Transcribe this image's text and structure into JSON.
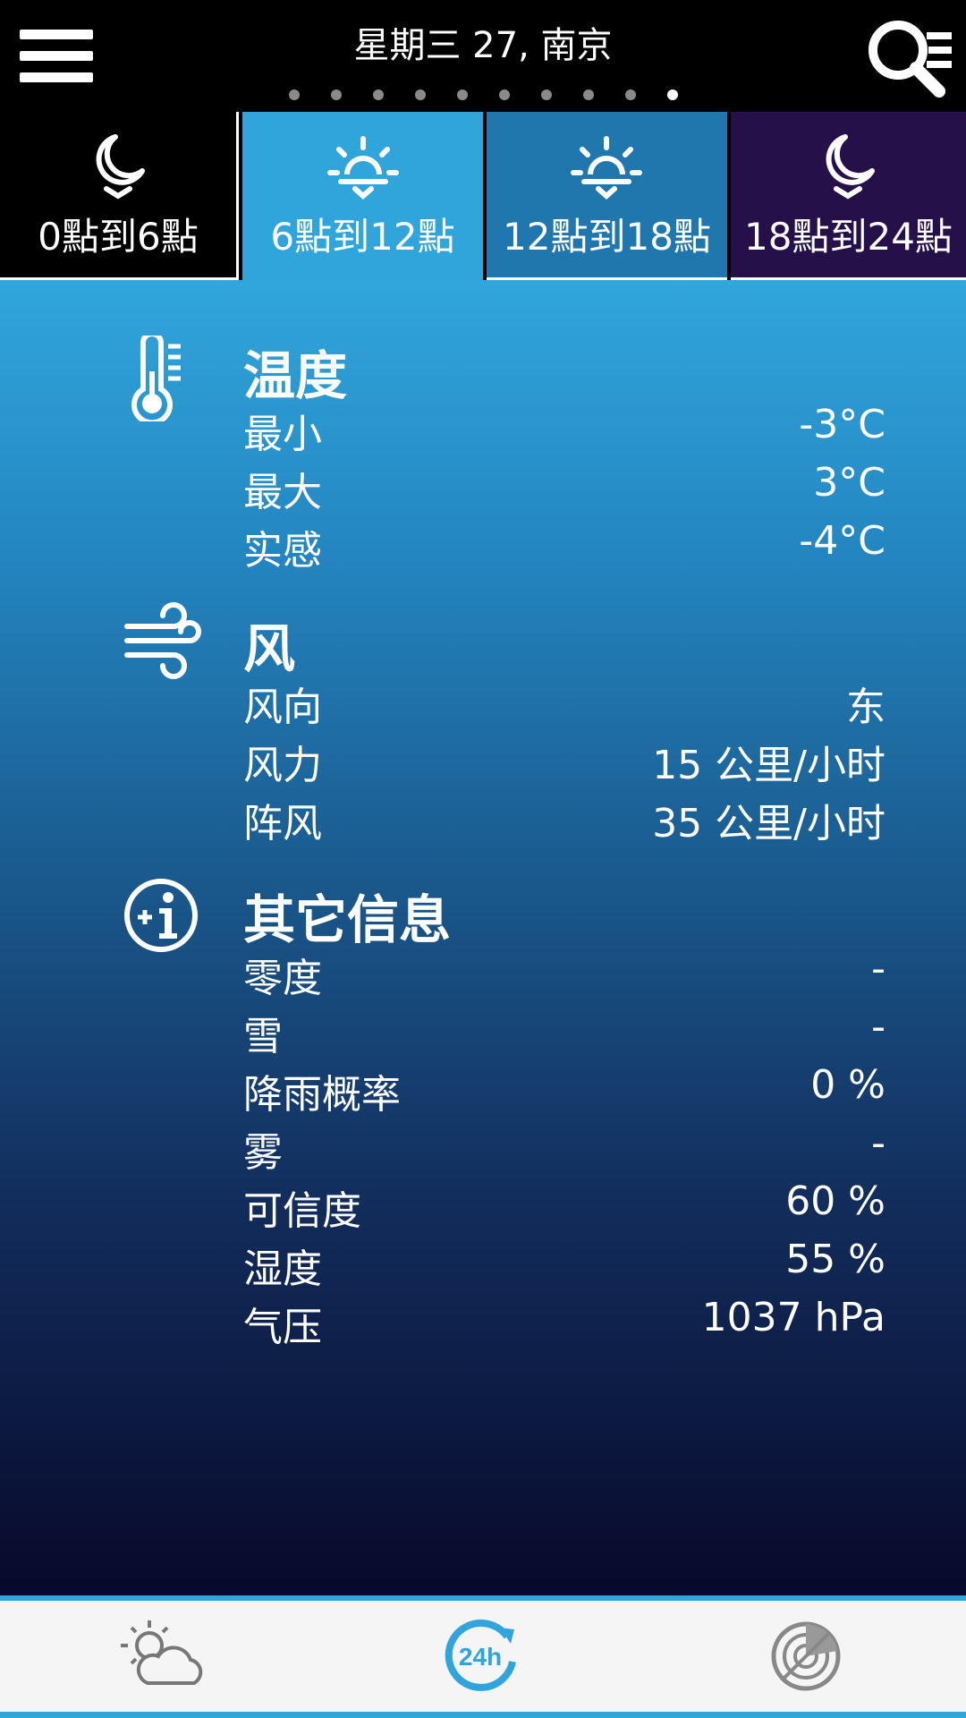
{
  "header": {
    "title": "星期三 27, 南京",
    "page_count": 10,
    "active_page": 9
  },
  "tabs": [
    {
      "label": "0點到6點",
      "icon": "moon-icon",
      "active": false
    },
    {
      "label": "6點到12點",
      "icon": "sunrise-icon",
      "active": true
    },
    {
      "label": "12點到18點",
      "icon": "sunrise-icon",
      "active": false
    },
    {
      "label": "18點到24點",
      "icon": "moon-icon",
      "active": false
    }
  ],
  "temperature": {
    "title": "温度",
    "rows": [
      {
        "label": "最小",
        "value": "-3°C"
      },
      {
        "label": "最大",
        "value": "3°C"
      },
      {
        "label": "实感",
        "value": "-4°C"
      }
    ]
  },
  "wind": {
    "title": "风",
    "rows": [
      {
        "label": "风向",
        "value": "东"
      },
      {
        "label": "风力",
        "value": "15 公里/小时"
      },
      {
        "label": "阵风",
        "value": "35 公里/小时"
      }
    ]
  },
  "other": {
    "title": "其它信息",
    "rows": [
      {
        "label": "零度",
        "value": "-"
      },
      {
        "label": "雪",
        "value": "-"
      },
      {
        "label": "降雨概率",
        "value": "0 %"
      },
      {
        "label": "雾",
        "value": "-"
      },
      {
        "label": "可信度",
        "value": "60 %"
      },
      {
        "label": "湿度",
        "value": "55 %"
      },
      {
        "label": "气压",
        "value": "1037 hPa"
      }
    ]
  },
  "bottom_nav": {
    "items": [
      "forecast-icon",
      "24h-icon",
      "radar-icon"
    ],
    "active": "24h-icon",
    "label_24h": "24h"
  },
  "colors": {
    "accent": "#2fa5dc",
    "tab_night": "#000000",
    "tab_morning": "#2fa5dc",
    "tab_afternoon": "#1f77ad",
    "tab_evening": "#26104a"
  }
}
